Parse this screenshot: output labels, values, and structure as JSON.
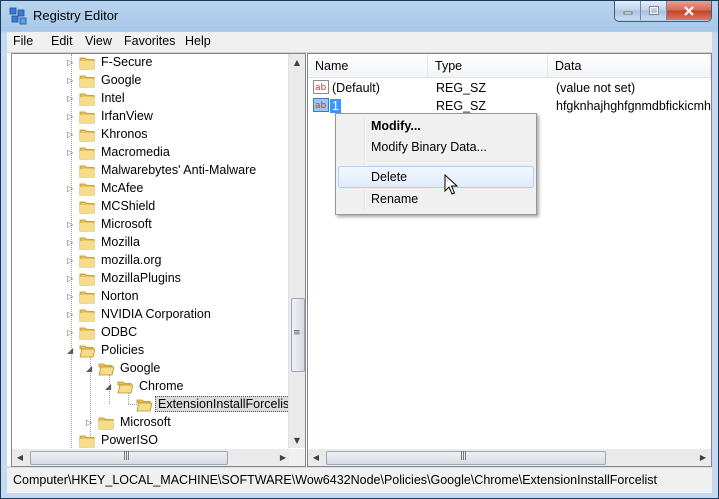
{
  "window": {
    "title": "Registry Editor",
    "icons": [
      "registry-editor-icon",
      "minimize-icon",
      "maximize-icon",
      "close-icon"
    ]
  },
  "menu": {
    "items": [
      {
        "label": "File"
      },
      {
        "label": "Edit"
      },
      {
        "label": "View"
      },
      {
        "label": "Favorites"
      },
      {
        "label": "Help"
      }
    ]
  },
  "tree": {
    "items": [
      {
        "label": "F-Secure",
        "expander": "collapsed"
      },
      {
        "label": "Google",
        "expander": "collapsed"
      },
      {
        "label": "Intel",
        "expander": "collapsed"
      },
      {
        "label": "IrfanView",
        "expander": "collapsed"
      },
      {
        "label": "Khronos",
        "expander": "collapsed"
      },
      {
        "label": "Macromedia",
        "expander": "collapsed"
      },
      {
        "label": "Malwarebytes' Anti-Malware",
        "expander": "none"
      },
      {
        "label": "McAfee",
        "expander": "collapsed"
      },
      {
        "label": "MCShield",
        "expander": "none"
      },
      {
        "label": "Microsoft",
        "expander": "collapsed"
      },
      {
        "label": "Mozilla",
        "expander": "collapsed"
      },
      {
        "label": "mozilla.org",
        "expander": "collapsed"
      },
      {
        "label": "MozillaPlugins",
        "expander": "collapsed"
      },
      {
        "label": "Norton",
        "expander": "collapsed"
      },
      {
        "label": "NVIDIA Corporation",
        "expander": "collapsed"
      },
      {
        "label": "ODBC",
        "expander": "collapsed"
      },
      {
        "label": "Policies",
        "expander": "expanded"
      },
      {
        "label": "Google",
        "expander": "expanded"
      },
      {
        "label": "Chrome",
        "expander": "expanded"
      },
      {
        "label": "ExtensionInstallForcelist",
        "expander": "none",
        "selected": true
      },
      {
        "label": "Microsoft",
        "expander": "collapsed"
      },
      {
        "label": "PowerISO",
        "expander": "none"
      }
    ]
  },
  "list": {
    "columns": [
      {
        "label": "Name"
      },
      {
        "label": "Type"
      },
      {
        "label": "Data"
      }
    ],
    "rows": [
      {
        "icon": "string-value-icon",
        "name": "(Default)",
        "type": "REG_SZ",
        "data": "(value not set)"
      },
      {
        "icon": "string-value-icon",
        "name": "1",
        "type": "REG_SZ",
        "data": "hfgknhajhghfgnmdbfickicmh"
      }
    ]
  },
  "context_menu": {
    "items": [
      {
        "label": "Modify...",
        "bold": true
      },
      {
        "label": "Modify Binary Data..."
      },
      {
        "label": "Delete",
        "highlighted": true
      },
      {
        "label": "Rename"
      }
    ]
  },
  "status": {
    "path": "Computer\\HKEY_LOCAL_MACHINE\\SOFTWARE\\Wow6432Node\\Policies\\Google\\Chrome\\ExtensionInstallForcelist"
  },
  "colors": {
    "selection": "#3399ff",
    "folder": "#e8c25a",
    "menu_highlight_border": "#aecff7"
  }
}
